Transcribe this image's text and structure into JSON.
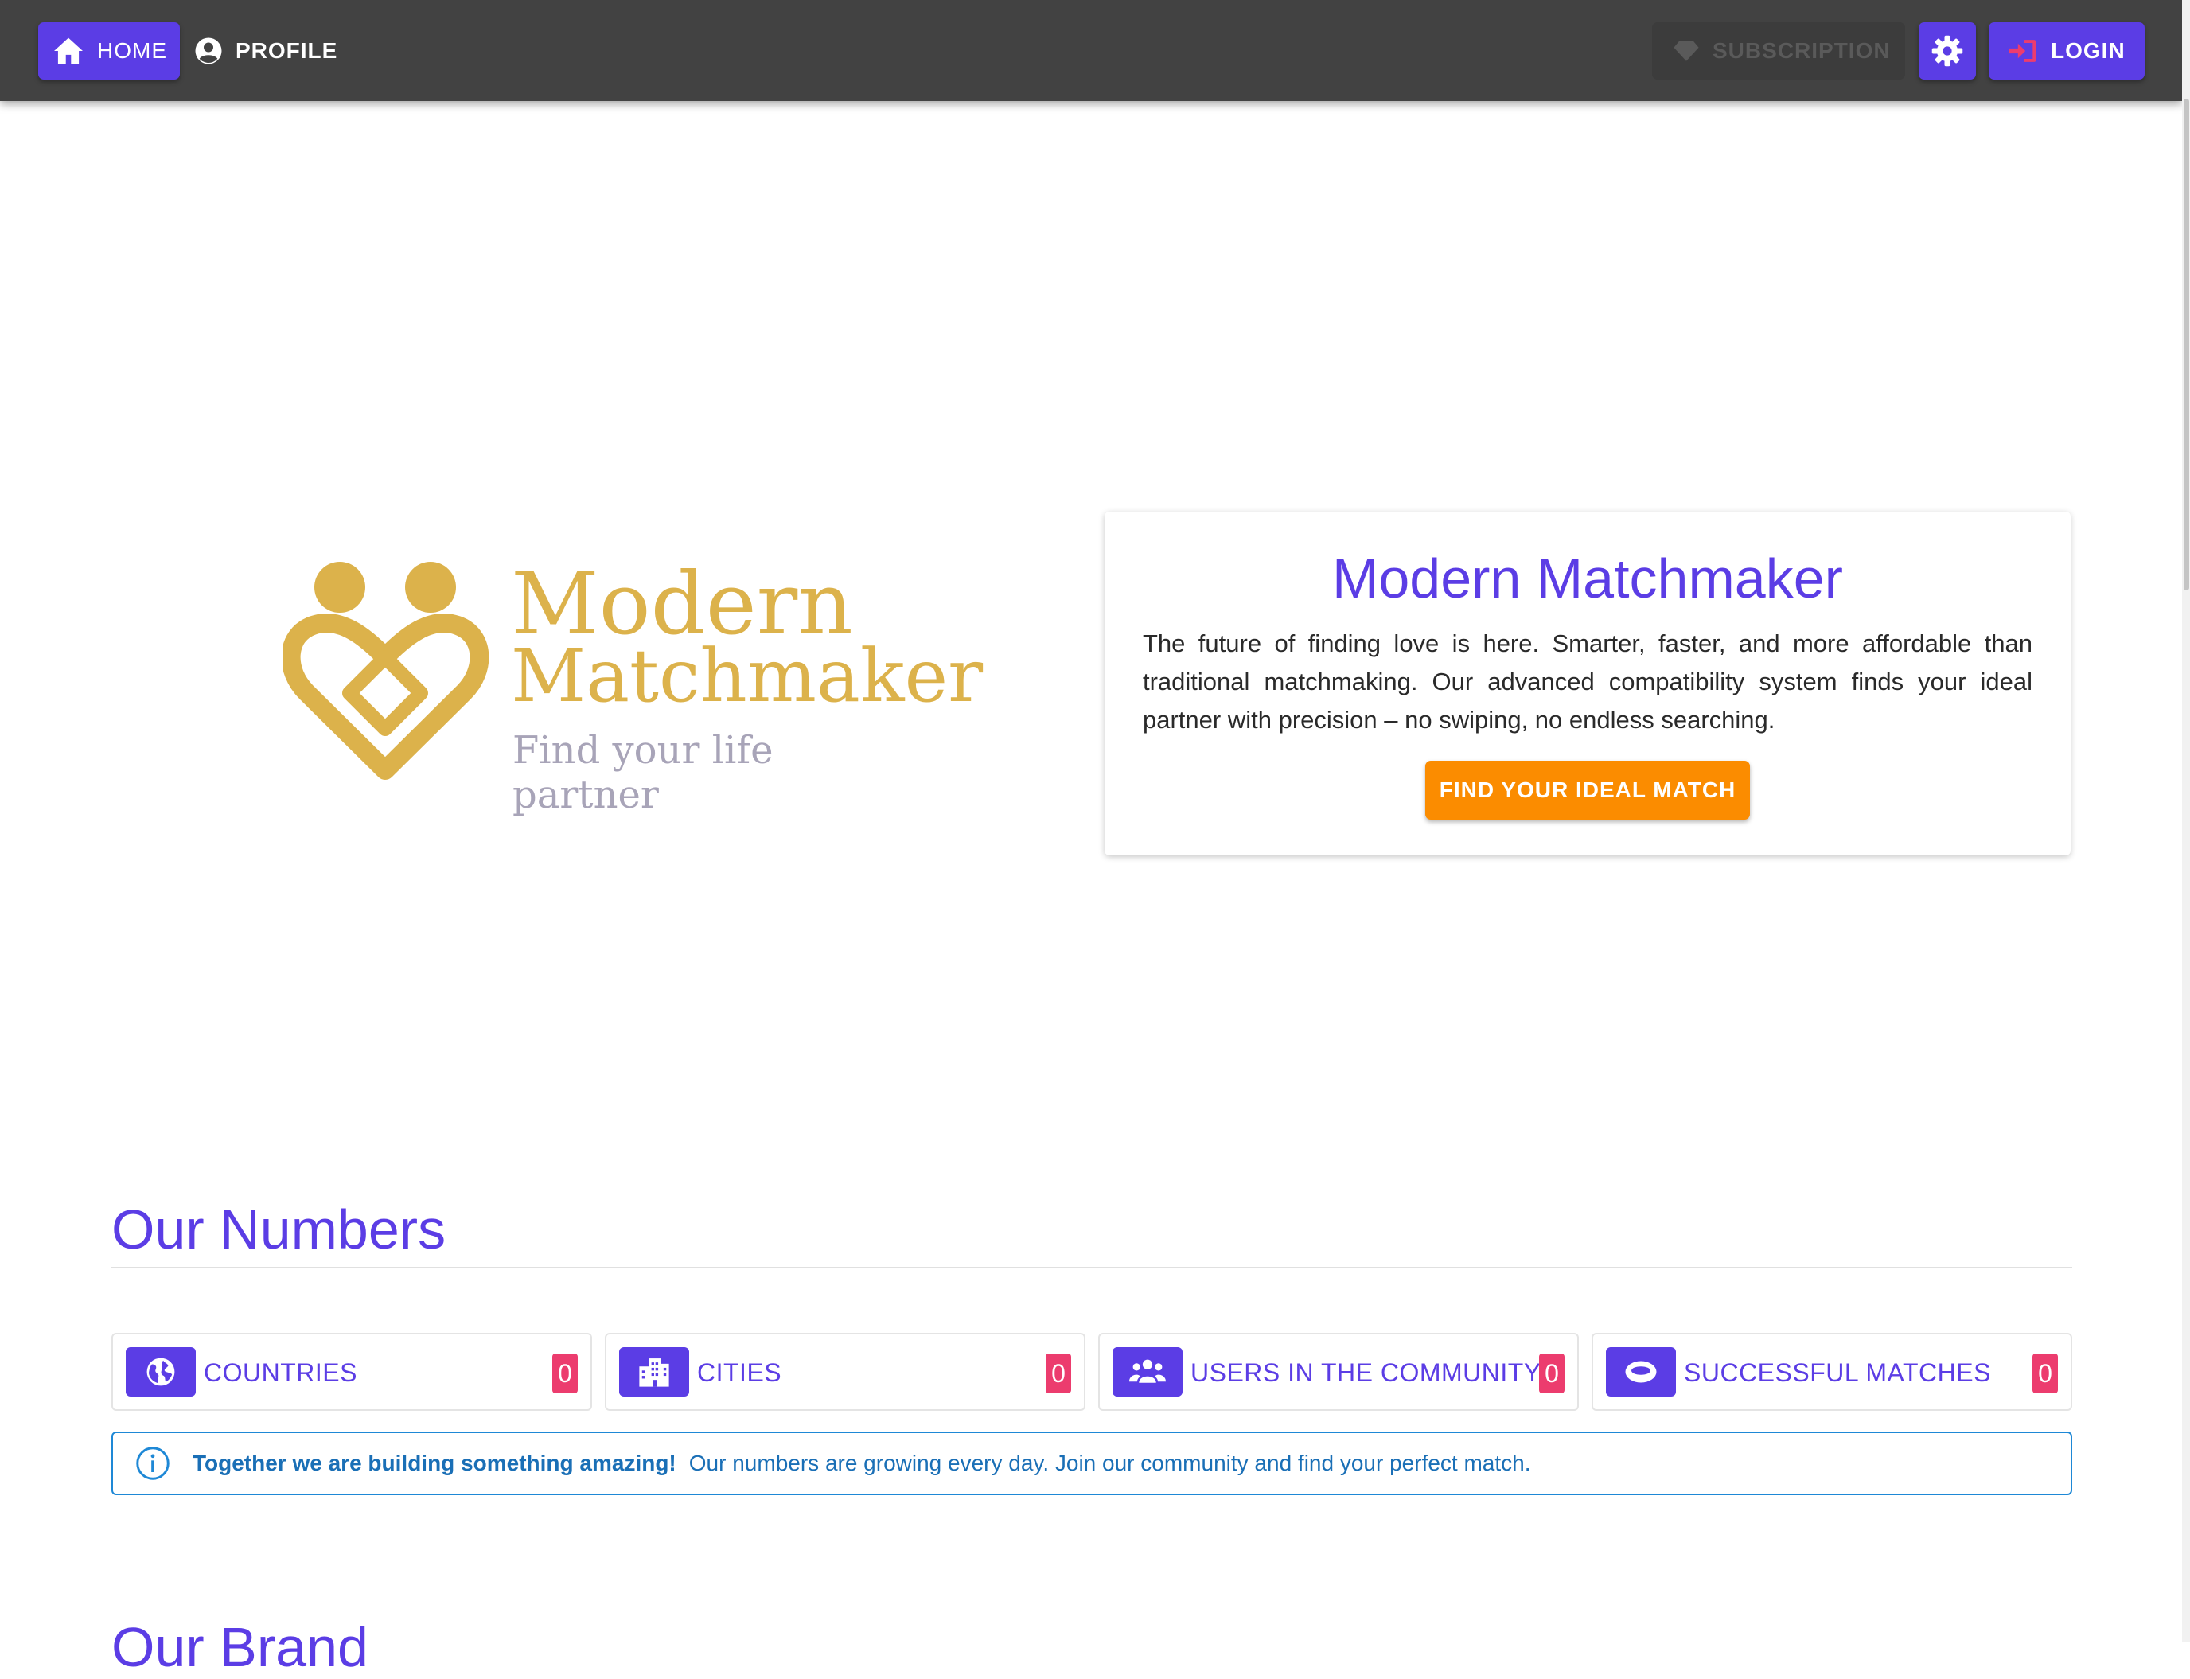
{
  "nav": {
    "home": "HOME",
    "profile": "PROFILE",
    "subscription": "SUBSCRIPTION",
    "login": "LOGIN",
    "home_icon": "home-icon",
    "profile_icon": "account-circle-icon",
    "subscription_icon": "diamond-icon",
    "settings_icon": "gear-icon",
    "login_icon": "login-icon"
  },
  "logo": {
    "line1": "Modern",
    "line2": "Matchmaker",
    "tagline": "Find your life partner"
  },
  "hero": {
    "title": "Modern Matchmaker",
    "text": "The future of finding love is here. Smarter, faster, and more affordable than traditional matchmaking. Our advanced compatibility system finds your ideal partner with precision – no swiping, no endless searching.",
    "button": "FIND YOUR IDEAL MATCH"
  },
  "numbers": {
    "title": "Our Numbers",
    "stats": [
      {
        "label": "COUNTRIES",
        "count": "0",
        "icon": "globe-icon"
      },
      {
        "label": "CITIES",
        "count": "0",
        "icon": "city-icon"
      },
      {
        "label": "USERS IN THE COMMUNITY",
        "count": "0",
        "icon": "users-icon"
      },
      {
        "label": "SUCCESSFUL MATCHES",
        "count": "0",
        "icon": "ring-icon"
      }
    ],
    "info_strong": "Together we are building something amazing!",
    "info_text": "Our numbers are growing every day. Join our community and find your perfect match."
  },
  "next_section": {
    "title": "Our Brand"
  },
  "colors": {
    "primary": "#5b3de5",
    "topbar": "#424242",
    "accent_orange": "#fb8c00",
    "badge_pink": "#ec3c6e",
    "info_blue": "#1e88d6",
    "logo_gold": "#dcb24b"
  }
}
